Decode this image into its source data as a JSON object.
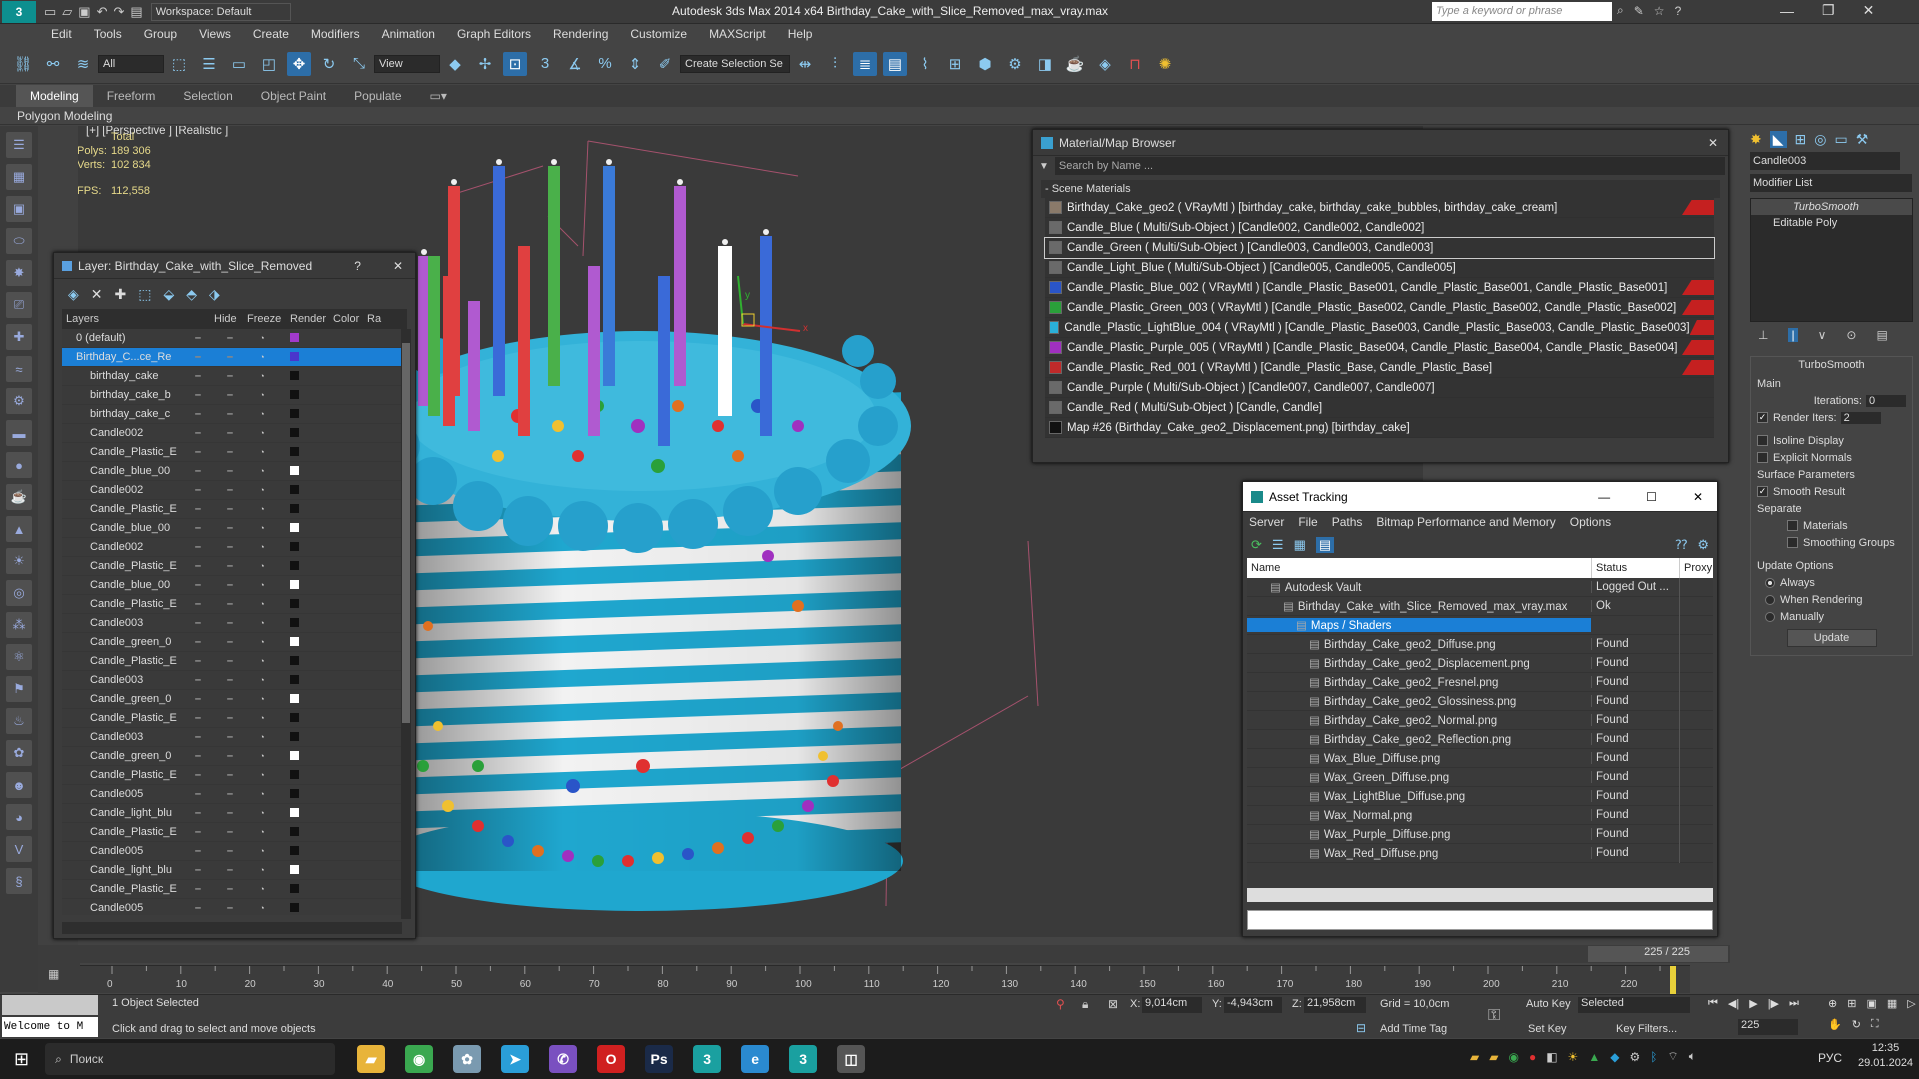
{
  "app": {
    "title": "Autodesk 3ds Max  2014 x64     Birthday_Cake_with_Slice_Removed_max_vray.max",
    "workspace": "Workspace: Default",
    "search_placeholder": "Type a keyword or phrase",
    "logo_glyph": "3"
  },
  "menu": [
    "Edit",
    "Tools",
    "Group",
    "Views",
    "Create",
    "Modifiers",
    "Animation",
    "Graph Editors",
    "Rendering",
    "Customize",
    "MAXScript",
    "Help"
  ],
  "toolbar": {
    "filter_select": "All",
    "ref_coord": "View",
    "selection_set": "Create Selection Se"
  },
  "ribbon": {
    "tabs": [
      "Modeling",
      "Freeform",
      "Selection",
      "Object Paint",
      "Populate"
    ],
    "sub_label": "Polygon Modeling"
  },
  "viewport": {
    "label": "[+] [Perspective ] [Realistic ]",
    "stats_total": "Total",
    "polys_label": "Polys:",
    "polys_value": "189 306",
    "verts_label": "Verts:",
    "verts_value": "102 834",
    "fps_label": "FPS:",
    "fps_value": "112,558"
  },
  "layer_window": {
    "title": "Layer: Birthday_Cake_with_Slice_Removed",
    "help": "?",
    "headers": [
      "Layers",
      "Hide",
      "Freeze",
      "Render",
      "Color",
      "Ra"
    ],
    "rows": [
      {
        "name": "0 (default)",
        "color": "#a13acb",
        "selected": false
      },
      {
        "name": "Birthday_C...ce_Re",
        "color": "#4a35cc",
        "selected": true
      },
      {
        "name": "birthday_cake",
        "color": "#111111",
        "selected": false
      },
      {
        "name": "birthday_cake_b",
        "color": "#111111",
        "selected": false
      },
      {
        "name": "birthday_cake_c",
        "color": "#111111",
        "selected": false
      },
      {
        "name": "Candle002",
        "color": "#111111",
        "selected": false
      },
      {
        "name": "Candle_Plastic_E",
        "color": "#111111",
        "selected": false
      },
      {
        "name": "Candle_blue_00",
        "color": "#ffffff",
        "selected": false
      },
      {
        "name": "Candle002",
        "color": "#111111",
        "selected": false
      },
      {
        "name": "Candle_Plastic_E",
        "color": "#111111",
        "selected": false
      },
      {
        "name": "Candle_blue_00",
        "color": "#ffffff",
        "selected": false
      },
      {
        "name": "Candle002",
        "color": "#111111",
        "selected": false
      },
      {
        "name": "Candle_Plastic_E",
        "color": "#111111",
        "selected": false
      },
      {
        "name": "Candle_blue_00",
        "color": "#ffffff",
        "selected": false
      },
      {
        "name": "Candle_Plastic_E",
        "color": "#111111",
        "selected": false
      },
      {
        "name": "Candle003",
        "color": "#111111",
        "selected": false
      },
      {
        "name": "Candle_green_0",
        "color": "#ffffff",
        "selected": false
      },
      {
        "name": "Candle_Plastic_E",
        "color": "#111111",
        "selected": false
      },
      {
        "name": "Candle003",
        "color": "#111111",
        "selected": false
      },
      {
        "name": "Candle_green_0",
        "color": "#ffffff",
        "selected": false
      },
      {
        "name": "Candle_Plastic_E",
        "color": "#111111",
        "selected": false
      },
      {
        "name": "Candle003",
        "color": "#111111",
        "selected": false
      },
      {
        "name": "Candle_green_0",
        "color": "#ffffff",
        "selected": false
      },
      {
        "name": "Candle_Plastic_E",
        "color": "#111111",
        "selected": false
      },
      {
        "name": "Candle005",
        "color": "#111111",
        "selected": false
      },
      {
        "name": "Candle_light_blu",
        "color": "#ffffff",
        "selected": false
      },
      {
        "name": "Candle_Plastic_E",
        "color": "#111111",
        "selected": false
      },
      {
        "name": "Candle005",
        "color": "#111111",
        "selected": false
      },
      {
        "name": "Candle_light_blu",
        "color": "#ffffff",
        "selected": false
      },
      {
        "name": "Candle_Plastic_E",
        "color": "#111111",
        "selected": false
      },
      {
        "name": "Candle005",
        "color": "#111111",
        "selected": false
      }
    ]
  },
  "material_browser": {
    "title": "Material/Map Browser",
    "search_placeholder": "Search by Name ...",
    "group": "- Scene Materials",
    "items": [
      {
        "text": "Birthday_Cake_geo2  ( VRayMtl ) [birthday_cake, birthday_cake_bubbles, birthday_cake_cream]",
        "icon": "#8a7a6a",
        "red": true,
        "sel": false
      },
      {
        "text": "Candle_Blue  ( Multi/Sub-Object ) [Candle002, Candle002, Candle002]",
        "icon": "#6a6a6a",
        "red": false,
        "sel": false
      },
      {
        "text": "Candle_Green  ( Multi/Sub-Object ) [Candle003, Candle003, Candle003]",
        "icon": "#6a6a6a",
        "red": false,
        "sel": true
      },
      {
        "text": "Candle_Light_Blue  ( Multi/Sub-Object ) [Candle005, Candle005, Candle005]",
        "icon": "#6a6a6a",
        "red": false,
        "sel": false
      },
      {
        "text": "Candle_Plastic_Blue_002  ( VRayMtl ) [Candle_Plastic_Base001, Candle_Plastic_Base001, Candle_Plastic_Base001]",
        "icon": "#2a55c8",
        "red": true,
        "sel": false
      },
      {
        "text": "Candle_Plastic_Green_003  ( VRayMtl ) [Candle_Plastic_Base002, Candle_Plastic_Base002, Candle_Plastic_Base002]",
        "icon": "#2aa03a",
        "red": true,
        "sel": false
      },
      {
        "text": "Candle_Plastic_LightBlue_004  ( VRayMtl ) [Candle_Plastic_Base003, Candle_Plastic_Base003, Candle_Plastic_Base003]",
        "icon": "#2ab0d8",
        "red": true,
        "sel": false
      },
      {
        "text": "Candle_Plastic_Purple_005  ( VRayMtl ) [Candle_Plastic_Base004, Candle_Plastic_Base004, Candle_Plastic_Base004]",
        "icon": "#a030c0",
        "red": true,
        "sel": false
      },
      {
        "text": "Candle_Plastic_Red_001  ( VRayMtl ) [Candle_Plastic_Base, Candle_Plastic_Base]",
        "icon": "#c02a2a",
        "red": true,
        "sel": false
      },
      {
        "text": "Candle_Purple  ( Multi/Sub-Object ) [Candle007, Candle007, Candle007]",
        "icon": "#6a6a6a",
        "red": false,
        "sel": false
      },
      {
        "text": "Candle_Red  ( Multi/Sub-Object ) [Candle, Candle]",
        "icon": "#6a6a6a",
        "red": false,
        "sel": false
      },
      {
        "text": "Map #26 (Birthday_Cake_geo2_Displacement.png) [birthday_cake]",
        "icon": "#111111",
        "red": false,
        "sel": false
      }
    ]
  },
  "asset_tracking": {
    "title": "Asset Tracking",
    "menu": [
      "Server",
      "File",
      "Paths",
      "Bitmap Performance and Memory",
      "Options"
    ],
    "headers": [
      "Name",
      "Status",
      "Proxy"
    ],
    "rows": [
      {
        "name": "Autodesk Vault",
        "status": "Logged Out ...",
        "indent": 1,
        "sel": false
      },
      {
        "name": "Birthday_Cake_with_Slice_Removed_max_vray.max",
        "status": "Ok",
        "indent": 2,
        "sel": false
      },
      {
        "name": "Maps / Shaders",
        "status": "",
        "indent": 3,
        "sel": true
      },
      {
        "name": "Birthday_Cake_geo2_Diffuse.png",
        "status": "Found",
        "indent": 4,
        "sel": false
      },
      {
        "name": "Birthday_Cake_geo2_Displacement.png",
        "status": "Found",
        "indent": 4,
        "sel": false
      },
      {
        "name": "Birthday_Cake_geo2_Fresnel.png",
        "status": "Found",
        "indent": 4,
        "sel": false
      },
      {
        "name": "Birthday_Cake_geo2_Glossiness.png",
        "status": "Found",
        "indent": 4,
        "sel": false
      },
      {
        "name": "Birthday_Cake_geo2_Normal.png",
        "status": "Found",
        "indent": 4,
        "sel": false
      },
      {
        "name": "Birthday_Cake_geo2_Reflection.png",
        "status": "Found",
        "indent": 4,
        "sel": false
      },
      {
        "name": "Wax_Blue_Diffuse.png",
        "status": "Found",
        "indent": 4,
        "sel": false
      },
      {
        "name": "Wax_Green_Diffuse.png",
        "status": "Found",
        "indent": 4,
        "sel": false
      },
      {
        "name": "Wax_LightBlue_Diffuse.png",
        "status": "Found",
        "indent": 4,
        "sel": false
      },
      {
        "name": "Wax_Normal.png",
        "status": "Found",
        "indent": 4,
        "sel": false
      },
      {
        "name": "Wax_Purple_Diffuse.png",
        "status": "Found",
        "indent": 4,
        "sel": false
      },
      {
        "name": "Wax_Red_Diffuse.png",
        "status": "Found",
        "indent": 4,
        "sel": false
      }
    ]
  },
  "command_panel": {
    "object_name": "Candle003",
    "modifier_list": "Modifier List",
    "stack": [
      "TurboSmooth",
      "Editable Poly"
    ],
    "rollout": "TurboSmooth",
    "main_label": "Main",
    "iterations_label": "Iterations:",
    "iterations_value": "0",
    "render_iters_label": "Render Iters:",
    "render_iters_value": "2",
    "isoline": "Isoline Display",
    "explicit": "Explicit Normals",
    "surface_label": "Surface Parameters",
    "smooth_result": "Smooth Result",
    "separate": "Separate",
    "materials": "Materials",
    "smoothing_groups": "Smoothing Groups",
    "update_options": "Update Options",
    "always": "Always",
    "when_rendering": "When Rendering",
    "manually": "Manually",
    "update_button": "Update"
  },
  "timeline": {
    "frame_counter": "225 / 225",
    "ticks": [
      "0",
      "10",
      "20",
      "30",
      "40",
      "50",
      "60",
      "70",
      "80",
      "90",
      "100",
      "110",
      "120",
      "130",
      "140",
      "150",
      "160",
      "170",
      "180",
      "190",
      "200",
      "210",
      "220"
    ],
    "range_max": 225
  },
  "status": {
    "maxscript": "Welcome to M",
    "selected": "1 Object Selected",
    "prompt": "Click and drag to select and move objects",
    "x_label": "X:",
    "x_value": "9,014cm",
    "y_label": "Y:",
    "y_value": "-4,943cm",
    "z_label": "Z:",
    "z_value": "21,958cm",
    "grid": "Grid = 10,0cm",
    "add_time_tag": "Add Time Tag",
    "auto_key": "Auto Key",
    "set_key": "Set Key",
    "selected_dd": "Selected",
    "key_filters": "Key Filters...",
    "frame_field": "225"
  },
  "taskbar": {
    "search": "Поиск",
    "lang": "РУС",
    "time": "12:35",
    "date": "29.01.2024",
    "apps": [
      {
        "name": "explorer",
        "glyph": "▰",
        "color": "#e8b43a"
      },
      {
        "name": "chrome",
        "glyph": "◉",
        "color": "#3aa850"
      },
      {
        "name": "settings",
        "glyph": "✿",
        "color": "#7a9ab0"
      },
      {
        "name": "telegram",
        "glyph": "➤",
        "color": "#2a9ed8"
      },
      {
        "name": "viber",
        "glyph": "✆",
        "color": "#7a50c0"
      },
      {
        "name": "opera",
        "glyph": "O",
        "color": "#d02020"
      },
      {
        "name": "photoshop",
        "glyph": "Ps",
        "color": "#1a2a48"
      },
      {
        "name": "3dsmax",
        "glyph": "3",
        "color": "#1aa0a0"
      },
      {
        "name": "edge",
        "glyph": "e",
        "color": "#2a8ad0"
      },
      {
        "name": "3dsmax-active",
        "glyph": "3",
        "color": "#1aa0a0"
      },
      {
        "name": "app",
        "glyph": "◫",
        "color": "#555555"
      }
    ]
  }
}
